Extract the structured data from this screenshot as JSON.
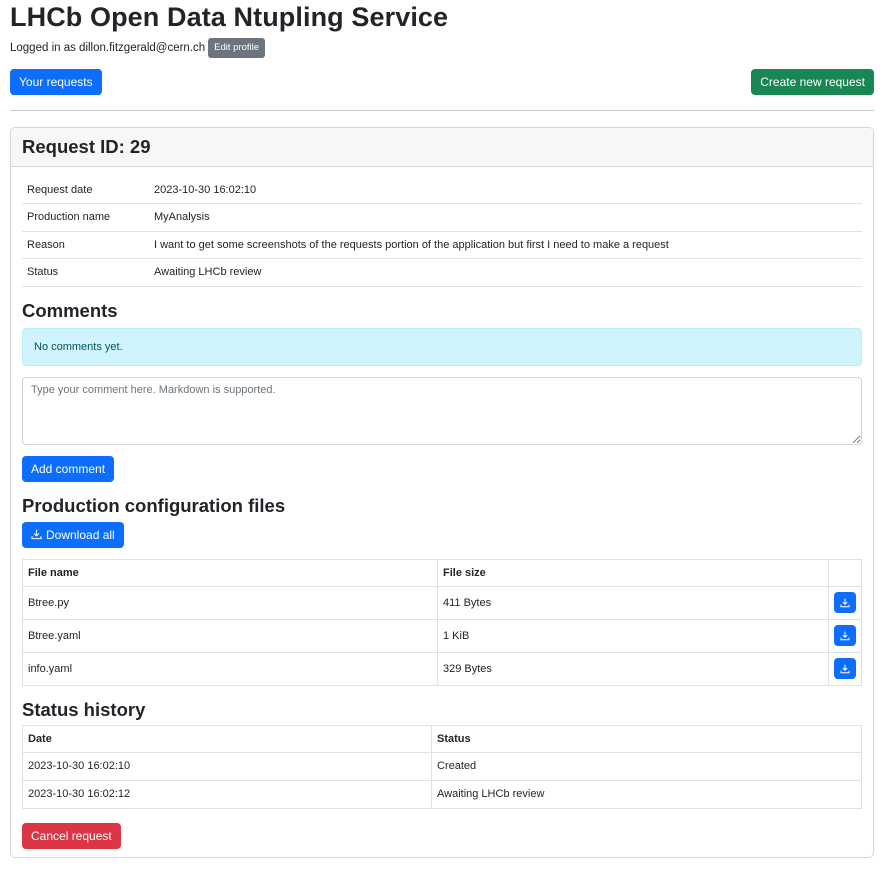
{
  "header": {
    "title": "LHCb Open Data Ntupling Service",
    "logged_in_text": "Logged in as dillon.fitzgerald@cern.ch",
    "edit_profile_label": "Edit profile"
  },
  "actions": {
    "your_requests_label": "Your requests",
    "create_request_label": "Create new request"
  },
  "request": {
    "title": "Request ID: 29",
    "info": [
      {
        "key": "Request date",
        "value": "2023-10-30 16:02:10"
      },
      {
        "key": "Production name",
        "value": "MyAnalysis"
      },
      {
        "key": "Reason",
        "value": "I want to get some screenshots of the requests portion of the application but first I need to make a request"
      },
      {
        "key": "Status",
        "value": "Awaiting LHCb review"
      }
    ]
  },
  "comments": {
    "heading": "Comments",
    "empty_message": "No comments yet.",
    "placeholder": "Type your comment here. Markdown is supported.",
    "add_label": "Add comment"
  },
  "files": {
    "heading": "Production configuration files",
    "download_all_label": "Download all",
    "columns": [
      "File name",
      "File size"
    ],
    "rows": [
      {
        "name": "Btree.py",
        "size": "411 Bytes"
      },
      {
        "name": "Btree.yaml",
        "size": "1 KiB"
      },
      {
        "name": "info.yaml",
        "size": "329 Bytes"
      }
    ]
  },
  "history": {
    "heading": "Status history",
    "columns": [
      "Date",
      "Status"
    ],
    "rows": [
      {
        "date": "2023-10-30 16:02:10",
        "status": "Created"
      },
      {
        "date": "2023-10-30 16:02:12",
        "status": "Awaiting LHCb review"
      }
    ]
  },
  "cancel_label": "Cancel request",
  "colors": {
    "primary": "#0d6efd",
    "success": "#198754",
    "danger": "#dc3545",
    "secondary": "#6c757d",
    "info_bg": "#cff4fc"
  },
  "icons": {
    "download": "download-icon"
  }
}
